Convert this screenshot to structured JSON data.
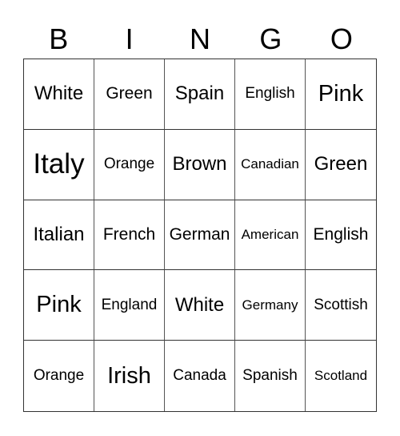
{
  "header": [
    "B",
    "I",
    "N",
    "G",
    "O"
  ],
  "cells": [
    [
      "White",
      "Green",
      "Spain",
      "English",
      "Pink"
    ],
    [
      "Italy",
      "Orange",
      "Brown",
      "Canadian",
      "Green"
    ],
    [
      "Italian",
      "French",
      "German",
      "American",
      "English"
    ],
    [
      "Pink",
      "England",
      "White",
      "Germany",
      "Scottish"
    ],
    [
      "Orange",
      "Irish",
      "Canada",
      "Spanish",
      "Scotland"
    ]
  ]
}
